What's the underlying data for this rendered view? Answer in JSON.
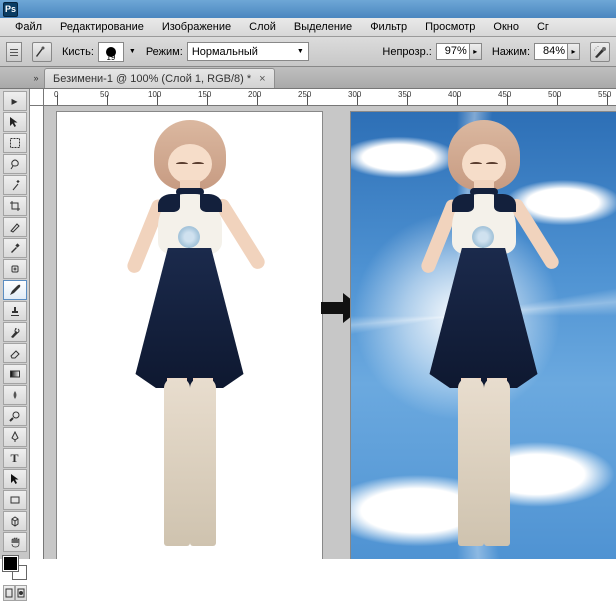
{
  "app": {
    "badge": "Ps"
  },
  "menu": {
    "file": "Файл",
    "edit": "Редактирование",
    "image": "Изображение",
    "layer": "Слой",
    "select": "Выделение",
    "filter": "Фильтр",
    "view": "Просмотр",
    "window": "Окно",
    "hel": "Сг"
  },
  "options": {
    "brush_label": "Кисть:",
    "brush_size": "19",
    "mode_label": "Режим:",
    "mode_value": "Нормальный",
    "opacity_label": "Непрозр.:",
    "opacity_value": "97%",
    "flow_label": "Нажим:",
    "flow_value": "84%"
  },
  "tabs": {
    "doc1": "Безимени-1 @ 100% (Слой 1, RGB/8) *"
  },
  "ruler": {
    "marks": [
      "0",
      "50",
      "100",
      "150",
      "200",
      "250",
      "300",
      "350",
      "400",
      "450",
      "500",
      "550"
    ]
  }
}
